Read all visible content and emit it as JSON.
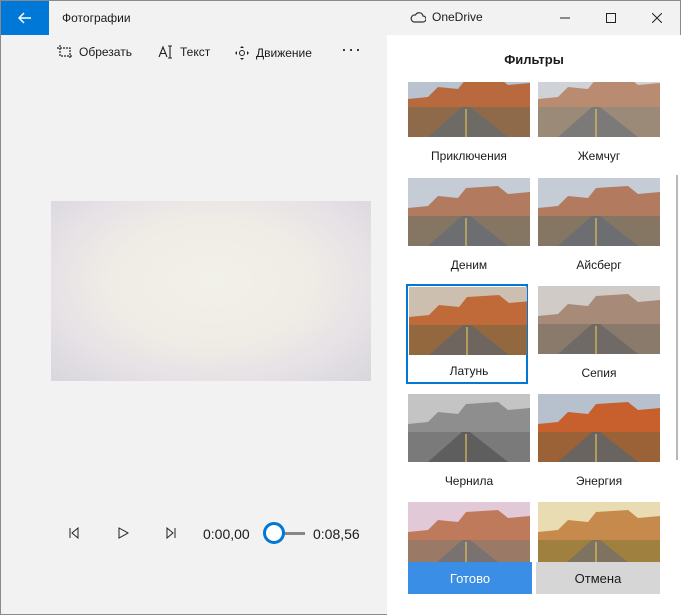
{
  "titlebar": {
    "app_title": "Фотографии",
    "onedrive_label": "OneDrive",
    "back_icon": "arrow-left-icon",
    "accent": "#0078d7"
  },
  "toolbar": {
    "crop_label": "Обрезать",
    "text_label": "Текст",
    "motion_label": "Движение",
    "more_label": "···"
  },
  "playback": {
    "current_time": "0:00,00",
    "end_time": "0:08,56",
    "position_fraction": 0.0
  },
  "filters": {
    "title": "Фильтры",
    "items": [
      {
        "label": "Приключения",
        "selected": false,
        "tone": "normal"
      },
      {
        "label": "Жемчуг",
        "selected": false,
        "tone": "pale"
      },
      {
        "label": "Деним",
        "selected": false,
        "tone": "cool"
      },
      {
        "label": "Айсберг",
        "selected": false,
        "tone": "cool"
      },
      {
        "label": "Латунь",
        "selected": true,
        "tone": "warm"
      },
      {
        "label": "Сепия",
        "selected": false,
        "tone": "sepia"
      },
      {
        "label": "Чернила",
        "selected": false,
        "tone": "gray"
      },
      {
        "label": "Энергия",
        "selected": false,
        "tone": "vivid"
      },
      {
        "label": "",
        "selected": false,
        "tone": "pink"
      },
      {
        "label": "",
        "selected": false,
        "tone": "yellow"
      }
    ],
    "done_label": "Готово",
    "cancel_label": "Отмена"
  }
}
